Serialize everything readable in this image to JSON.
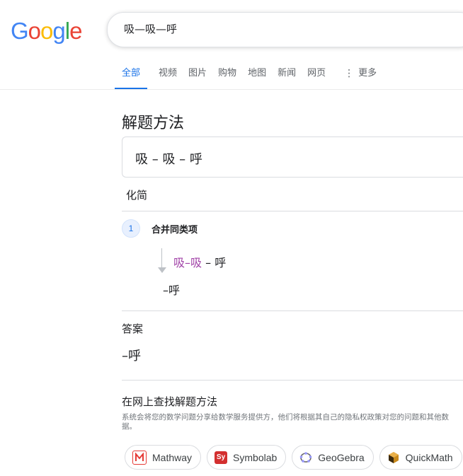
{
  "logo": {
    "letters": [
      "G",
      "o",
      "o",
      "g",
      "l",
      "e"
    ],
    "colors": [
      "#4285f4",
      "#ea4335",
      "#fbbc05",
      "#4285f4",
      "#34a853",
      "#ea4335"
    ]
  },
  "search": {
    "value": "吸—吸—呼"
  },
  "tabs": [
    {
      "label": "全部",
      "active": true
    },
    {
      "label": "视频"
    },
    {
      "label": "图片"
    },
    {
      "label": "购物"
    },
    {
      "label": "地图"
    },
    {
      "label": "新闻"
    },
    {
      "label": "网页"
    }
  ],
  "more_label": "更多",
  "solver": {
    "title": "解题方法",
    "expression": "吸 – 吸 – 呼",
    "mode": "化简",
    "step_number": "1",
    "step_title": "合并同类项",
    "step_expr_highlight": "吸–吸",
    "step_expr_rest": " – 呼",
    "step_result": "–呼",
    "answer_label": "答案",
    "answer_value": "–呼",
    "find_title": "在网上查找解题方法",
    "disclaimer": "系统会将您的数学问题分享给数学服务提供方，他们将根据其自己的隐私权政策对您的问题和其他数据。"
  },
  "providers": [
    {
      "name": "Mathway",
      "icon": "mathway-icon",
      "color": "#e53935"
    },
    {
      "name": "Symbolab",
      "icon": "symbolab-icon",
      "color": "#d32f2f"
    },
    {
      "name": "GeoGebra",
      "icon": "geogebra-icon",
      "color": "#666666"
    },
    {
      "name": "QuickMath",
      "icon": "quickmath-icon",
      "color": "#333333"
    }
  ],
  "colors": {
    "accent": "#1a73e8",
    "highlight": "#a142a7",
    "border": "#dadce0"
  }
}
